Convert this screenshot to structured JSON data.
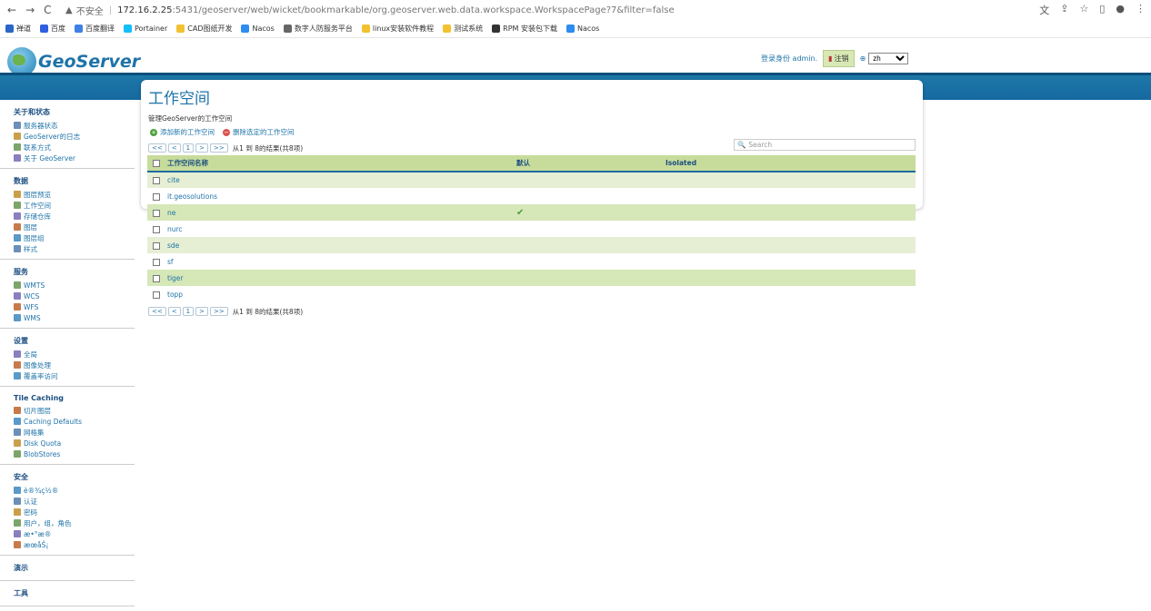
{
  "browser": {
    "insecure_label": "不安全",
    "url_host": "172.16.2.25",
    "url_path": ":5431/geoserver/web/wicket/bookmarkable/org.geoserver.web.data.workspace.WorkspacePage?7&filter=false",
    "bookmarks": [
      {
        "label": "禅道",
        "color": "#2a66c8"
      },
      {
        "label": "百度",
        "color": "#2f5fe0"
      },
      {
        "label": "百度翻译",
        "color": "#3f7fe8"
      },
      {
        "label": "Portainer",
        "color": "#13bef9"
      },
      {
        "label": "CAD图纸开发",
        "color": "#f2c230"
      },
      {
        "label": "Nacos",
        "color": "#2d8cf0"
      },
      {
        "label": "数字人防服务平台",
        "color": "#666666"
      },
      {
        "label": "linux安装软件教程",
        "color": "#f2c230"
      },
      {
        "label": "测试系统",
        "color": "#f2c230"
      },
      {
        "label": "RPM 安装包下载",
        "color": "#333333"
      },
      {
        "label": "Nacos",
        "color": "#2d8cf0"
      }
    ]
  },
  "header": {
    "logo_text": "GeoServer",
    "logged_in_as": "登录身份 admin.",
    "logout_label": "注销",
    "language": "zh"
  },
  "sidebar": {
    "sections": [
      {
        "title": "关于和状态",
        "items": [
          "服务器状态",
          "GeoServer的日志",
          "联系方式",
          "关于 GeoServer"
        ]
      },
      {
        "title": "数据",
        "items": [
          "图层预览",
          "工作空间",
          "存储仓库",
          "图层",
          "图层组",
          "样式"
        ]
      },
      {
        "title": "服务",
        "items": [
          "WMTS",
          "WCS",
          "WFS",
          "WMS"
        ]
      },
      {
        "title": "设置",
        "items": [
          "全局",
          "图像处理",
          "覆盖率访问"
        ]
      },
      {
        "title": "Tile Caching",
        "items": [
          "切片图层",
          "Caching Defaults",
          "网格集",
          "Disk Quota",
          "BlobStores"
        ]
      },
      {
        "title": "安全",
        "items": [
          "è®¾ç½®",
          "认证",
          "密码",
          "用户，组，角色",
          "æ•°æ®",
          "æœåŠ¡"
        ]
      },
      {
        "title": "演示",
        "items": []
      },
      {
        "title": "工具",
        "items": []
      }
    ]
  },
  "main": {
    "title": "工作空间",
    "description": "管理GeoServer的工作空间",
    "add_label": "添加新的工作空间",
    "remove_label": "删除选定的工作空间",
    "pager": {
      "first": "<<",
      "prev": "<",
      "page": "1",
      "next": ">",
      "last": ">>",
      "info": "从1 到 8的结果(共8项)"
    },
    "search_placeholder": "Search",
    "columns": [
      "工作空间名称",
      "默认",
      "Isolated"
    ],
    "rows": [
      {
        "name": "cite",
        "default": false
      },
      {
        "name": "it.geosolutions",
        "default": false
      },
      {
        "name": "ne",
        "default": true
      },
      {
        "name": "nurc",
        "default": false
      },
      {
        "name": "sde",
        "default": false
      },
      {
        "name": "sf",
        "default": false
      },
      {
        "name": "tiger",
        "default": false
      },
      {
        "name": "topp",
        "default": false
      }
    ]
  }
}
